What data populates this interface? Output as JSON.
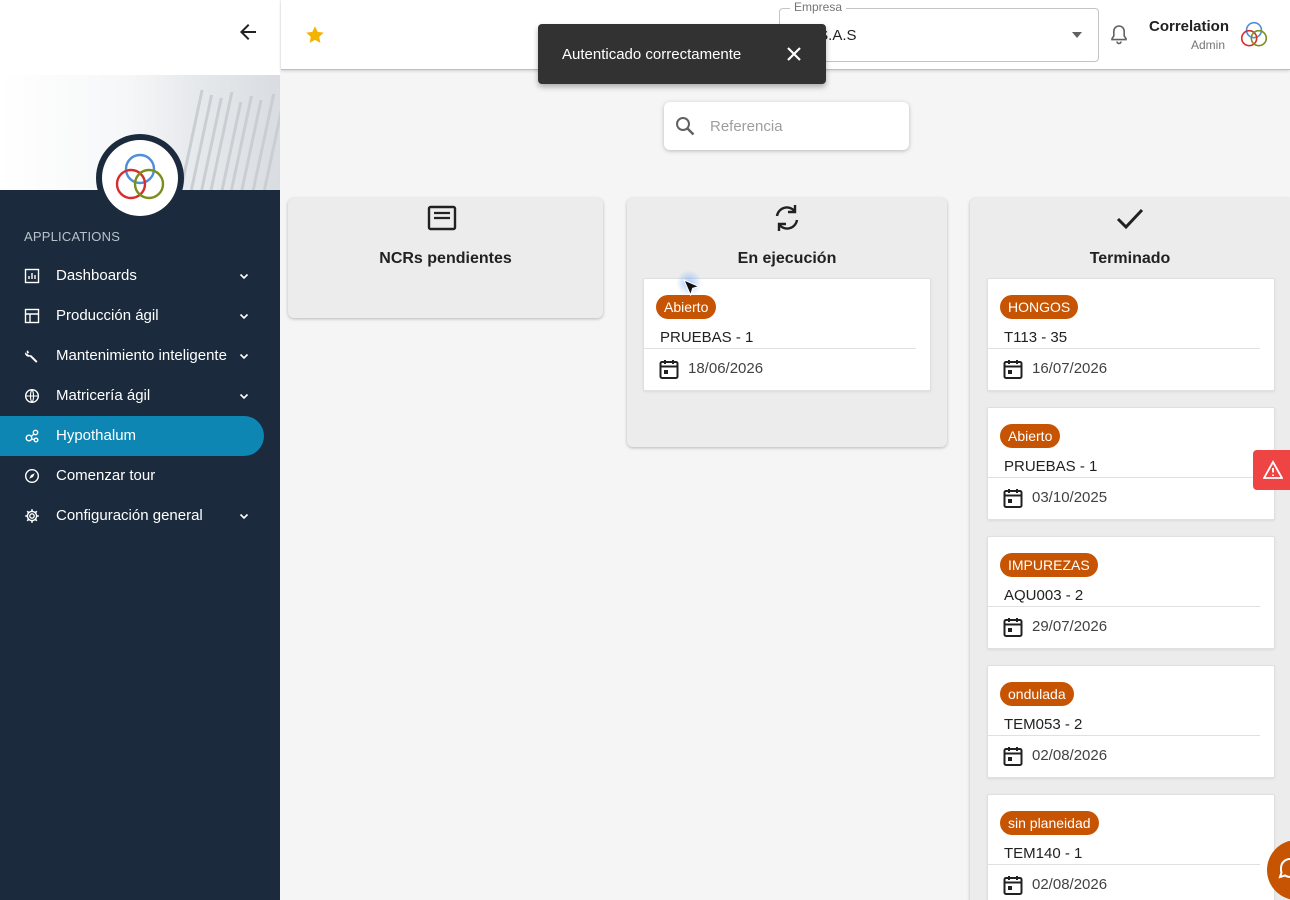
{
  "sidebar": {
    "apps_heading": "APPLICATIONS",
    "items": [
      {
        "label": "Dashboards",
        "icon": "chart-icon",
        "has_children": true
      },
      {
        "label": "Producción ágil",
        "icon": "table-icon",
        "has_children": true
      },
      {
        "label": "Mantenimiento inteligente",
        "icon": "wrench-icon",
        "has_children": true
      },
      {
        "label": "Matricería ágil",
        "icon": "globe-icon",
        "has_children": true
      },
      {
        "label": "Hypothalum",
        "icon": "hub-icon",
        "has_children": false,
        "active": true
      },
      {
        "label": "Comenzar tour",
        "icon": "compass-icon",
        "has_children": false
      },
      {
        "label": "Configuración general",
        "icon": "gear-icon",
        "has_children": true
      }
    ]
  },
  "header": {
    "empresa_label": "Empresa",
    "empresa_value": "CA S.A.S",
    "user_name": "Correlation",
    "user_role": "Admin"
  },
  "snackbar": {
    "message": "Autenticado correctamente"
  },
  "search": {
    "placeholder": "Referencia"
  },
  "columns": [
    {
      "title": "NCRs pendientes",
      "icon": "note-icon",
      "cards": []
    },
    {
      "title": "En ejecución",
      "icon": "sync-icon",
      "cards": [
        {
          "tag": "Abierto",
          "ref": "PRUEBAS - 1",
          "date": "18/06/2026"
        }
      ]
    },
    {
      "title": "Terminado",
      "icon": "check-icon",
      "cards": [
        {
          "tag": "HONGOS",
          "ref": "T113 - 35",
          "date": "16/07/2026"
        },
        {
          "tag": "Abierto",
          "ref": "PRUEBAS - 1",
          "date": "03/10/2025"
        },
        {
          "tag": "IMPUREZAS",
          "ref": "AQU003 - 2",
          "date": "29/07/2026"
        },
        {
          "tag": "ondulada",
          "ref": "TEM053 - 2",
          "date": "02/08/2026"
        },
        {
          "tag": "sin planeidad",
          "ref": "TEM140 - 1",
          "date": "02/08/2026"
        }
      ]
    }
  ],
  "colors": {
    "sidebar_bg": "#1b2a3c",
    "active_nav": "#0e86b4",
    "chip_bg": "#c65402",
    "snackbar_bg": "#323232",
    "warning": "#ee4444",
    "star": "#f5b301"
  }
}
